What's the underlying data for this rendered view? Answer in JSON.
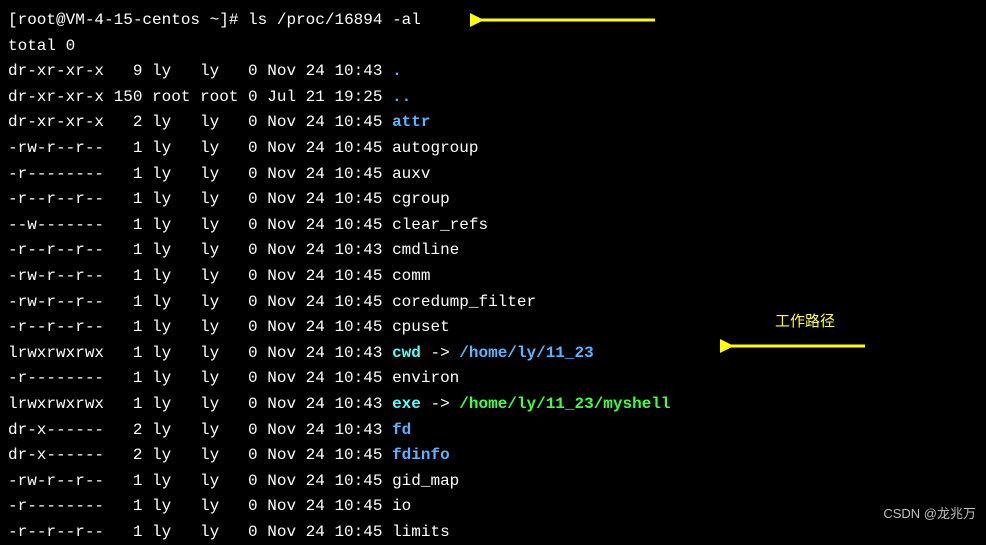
{
  "prompt": {
    "user_host": "[root@VM-4-15-centos ~]#",
    "command": "ls /proc/16894 -al"
  },
  "total_line": "total 0",
  "rows": [
    {
      "perm": "dr-xr-xr-x",
      "links": "9",
      "owner": "ly",
      "group": "ly",
      "size": "0",
      "month": "Nov",
      "day": "24",
      "time": "10:43",
      "name": ".",
      "cls": "dir"
    },
    {
      "perm": "dr-xr-xr-x",
      "links": "150",
      "owner": "root",
      "group": "root",
      "size": "0",
      "month": "Jul",
      "day": "21",
      "time": "19:25",
      "name": "..",
      "cls": "dir"
    },
    {
      "perm": "dr-xr-xr-x",
      "links": "2",
      "owner": "ly",
      "group": "ly",
      "size": "0",
      "month": "Nov",
      "day": "24",
      "time": "10:45",
      "name": "attr",
      "cls": "dir"
    },
    {
      "perm": "-rw-r--r--",
      "links": "1",
      "owner": "ly",
      "group": "ly",
      "size": "0",
      "month": "Nov",
      "day": "24",
      "time": "10:45",
      "name": "autogroup",
      "cls": "plain"
    },
    {
      "perm": "-r--------",
      "links": "1",
      "owner": "ly",
      "group": "ly",
      "size": "0",
      "month": "Nov",
      "day": "24",
      "time": "10:45",
      "name": "auxv",
      "cls": "plain"
    },
    {
      "perm": "-r--r--r--",
      "links": "1",
      "owner": "ly",
      "group": "ly",
      "size": "0",
      "month": "Nov",
      "day": "24",
      "time": "10:45",
      "name": "cgroup",
      "cls": "plain"
    },
    {
      "perm": "--w-------",
      "links": "1",
      "owner": "ly",
      "group": "ly",
      "size": "0",
      "month": "Nov",
      "day": "24",
      "time": "10:45",
      "name": "clear_refs",
      "cls": "plain"
    },
    {
      "perm": "-r--r--r--",
      "links": "1",
      "owner": "ly",
      "group": "ly",
      "size": "0",
      "month": "Nov",
      "day": "24",
      "time": "10:43",
      "name": "cmdline",
      "cls": "plain"
    },
    {
      "perm": "-rw-r--r--",
      "links": "1",
      "owner": "ly",
      "group": "ly",
      "size": "0",
      "month": "Nov",
      "day": "24",
      "time": "10:45",
      "name": "comm",
      "cls": "plain"
    },
    {
      "perm": "-rw-r--r--",
      "links": "1",
      "owner": "ly",
      "group": "ly",
      "size": "0",
      "month": "Nov",
      "day": "24",
      "time": "10:45",
      "name": "coredump_filter",
      "cls": "plain"
    },
    {
      "perm": "-r--r--r--",
      "links": "1",
      "owner": "ly",
      "group": "ly",
      "size": "0",
      "month": "Nov",
      "day": "24",
      "time": "10:45",
      "name": "cpuset",
      "cls": "plain"
    },
    {
      "perm": "lrwxrwxrwx",
      "links": "1",
      "owner": "ly",
      "group": "ly",
      "size": "0",
      "month": "Nov",
      "day": "24",
      "time": "10:43",
      "name": "cwd",
      "cls": "link",
      "arrow": " -> ",
      "target": "/home/ly/11_23",
      "tcls": "linktarget"
    },
    {
      "perm": "-r--------",
      "links": "1",
      "owner": "ly",
      "group": "ly",
      "size": "0",
      "month": "Nov",
      "day": "24",
      "time": "10:45",
      "name": "environ",
      "cls": "plain"
    },
    {
      "perm": "lrwxrwxrwx",
      "links": "1",
      "owner": "ly",
      "group": "ly",
      "size": "0",
      "month": "Nov",
      "day": "24",
      "time": "10:43",
      "name": "exe",
      "cls": "link",
      "arrow": " -> ",
      "target": "/home/ly/11_23/myshell",
      "tcls": "exe"
    },
    {
      "perm": "dr-x------",
      "links": "2",
      "owner": "ly",
      "group": "ly",
      "size": "0",
      "month": "Nov",
      "day": "24",
      "time": "10:43",
      "name": "fd",
      "cls": "dir"
    },
    {
      "perm": "dr-x------",
      "links": "2",
      "owner": "ly",
      "group": "ly",
      "size": "0",
      "month": "Nov",
      "day": "24",
      "time": "10:45",
      "name": "fdinfo",
      "cls": "dir"
    },
    {
      "perm": "-rw-r--r--",
      "links": "1",
      "owner": "ly",
      "group": "ly",
      "size": "0",
      "month": "Nov",
      "day": "24",
      "time": "10:45",
      "name": "gid_map",
      "cls": "plain"
    },
    {
      "perm": "-r--------",
      "links": "1",
      "owner": "ly",
      "group": "ly",
      "size": "0",
      "month": "Nov",
      "day": "24",
      "time": "10:45",
      "name": "io",
      "cls": "plain"
    },
    {
      "perm": "-r--r--r--",
      "links": "1",
      "owner": "ly",
      "group": "ly",
      "size": "0",
      "month": "Nov",
      "day": "24",
      "time": "10:45",
      "name": "limits",
      "cls": "plain"
    }
  ],
  "annotation": {
    "label": "工作路径"
  },
  "watermark": "CSDN @龙兆万"
}
